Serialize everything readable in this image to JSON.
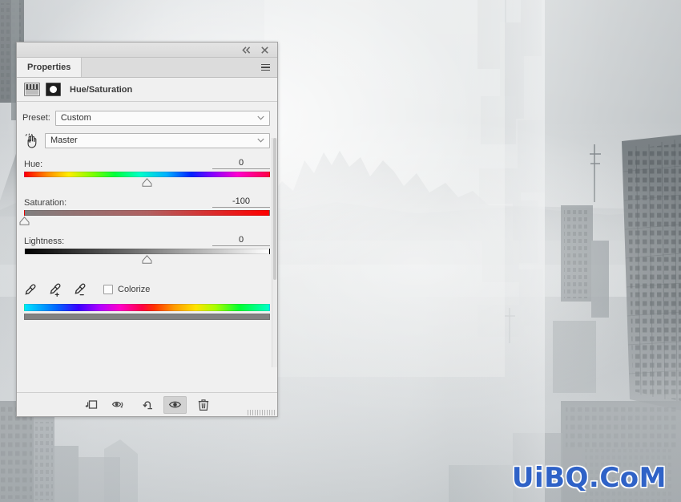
{
  "app": {
    "panel_title": "Properties"
  },
  "titlebar": {
    "collapse_icon": "double-chevron-left-icon",
    "close_icon": "close-icon"
  },
  "panel": {
    "tab_label": "Properties",
    "menu_icon": "panel-menu-icon",
    "adjustment_title": "Hue/Saturation",
    "adjustment_icon": "hue-saturation-adjustment-icon",
    "mask_icon": "layer-mask-thumbnail-icon",
    "on_image_tool_icon": "on-image-adjustment-hand-icon"
  },
  "preset": {
    "label": "Preset:",
    "value": "Custom",
    "chevron": "chevron-down-icon"
  },
  "channel": {
    "value": "Master",
    "chevron": "chevron-down-icon"
  },
  "sliders": [
    {
      "id": "hue",
      "label": "Hue:",
      "value": "0",
      "thumb_percent": 50,
      "min": -180,
      "max": 180
    },
    {
      "id": "saturation",
      "label": "Saturation:",
      "value": "-100",
      "thumb_percent": 0,
      "min": -100,
      "max": 100
    },
    {
      "id": "lightness",
      "label": "Lightness:",
      "value": "0",
      "thumb_percent": 50,
      "min": -100,
      "max": 100
    }
  ],
  "tools": {
    "eyedropper": "eyedropper-icon",
    "eyedropper_add": "eyedropper-add-icon",
    "eyedropper_subtract": "eyedropper-subtract-icon",
    "colorize_label": "Colorize",
    "colorize_checked": false
  },
  "footer": {
    "buttons": [
      {
        "name": "clip-to-layer-button",
        "icon": "clip-to-layer-icon",
        "active": false
      },
      {
        "name": "toggle-previous-state-button",
        "icon": "eye-previous-state-icon",
        "active": false
      },
      {
        "name": "reset-button",
        "icon": "reset-arrow-icon",
        "active": false
      },
      {
        "name": "toggle-visibility-button",
        "icon": "eye-icon",
        "active": true
      },
      {
        "name": "delete-layer-button",
        "icon": "trash-icon",
        "active": false
      }
    ]
  },
  "watermark": {
    "text": "UiBQ.CoM",
    "color": "#2f62c7"
  },
  "colors": {
    "panel_bg": "#f0f0f0",
    "panel_border": "#a3a3a3",
    "tab_bg": "#dcdcdc",
    "text": "#3d3d3d",
    "photo_haze": "#e3e6e7",
    "photo_dark": "#5e6569"
  }
}
